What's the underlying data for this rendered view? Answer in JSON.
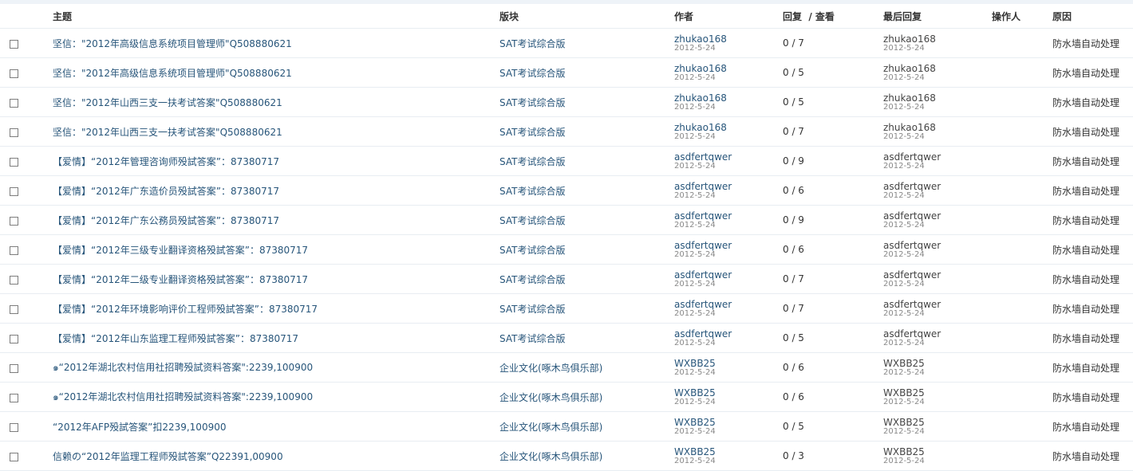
{
  "header": {
    "subject": "主题",
    "forum": "版块",
    "author": "作者",
    "replies_views": "回复  / 查看",
    "last_reply": "最后回复",
    "operator": "操作人",
    "reason": "原因"
  },
  "rows": [
    {
      "subject": "坚信：\"2012年高级信息系统项目管理师\"Q508880621",
      "forum": "SAT考试综合版",
      "author": "zhukao168",
      "author_date": "2012-5-24",
      "replies": "0 / 7",
      "last_user": "zhukao168",
      "last_date": "2012-5-24",
      "operator": "",
      "reason": "防水墙自动处理"
    },
    {
      "subject": "坚信：\"2012年高级信息系统项目管理师\"Q508880621",
      "forum": "SAT考试综合版",
      "author": "zhukao168",
      "author_date": "2012-5-24",
      "replies": "0 / 5",
      "last_user": "zhukao168",
      "last_date": "2012-5-24",
      "operator": "",
      "reason": "防水墙自动处理"
    },
    {
      "subject": "坚信：\"2012年山西三支一扶考试答案\"Q508880621",
      "forum": "SAT考试综合版",
      "author": "zhukao168",
      "author_date": "2012-5-24",
      "replies": "0 / 5",
      "last_user": "zhukao168",
      "last_date": "2012-5-24",
      "operator": "",
      "reason": "防水墙自动处理"
    },
    {
      "subject": "坚信：\"2012年山西三支一扶考试答案\"Q508880621",
      "forum": "SAT考试综合版",
      "author": "zhukao168",
      "author_date": "2012-5-24",
      "replies": "0 / 7",
      "last_user": "zhukao168",
      "last_date": "2012-5-24",
      "operator": "",
      "reason": "防水墙自动处理"
    },
    {
      "subject": "【爱情】“2012年管理咨询师殁試答案”：87380717",
      "forum": "SAT考试综合版",
      "author": "asdfertqwer",
      "author_date": "2012-5-24",
      "replies": "0 / 9",
      "last_user": "asdfertqwer",
      "last_date": "2012-5-24",
      "operator": "",
      "reason": "防水墙自动处理"
    },
    {
      "subject": "【爱情】“2012年广东造价员殁試答案”：87380717",
      "forum": "SAT考试综合版",
      "author": "asdfertqwer",
      "author_date": "2012-5-24",
      "replies": "0 / 6",
      "last_user": "asdfertqwer",
      "last_date": "2012-5-24",
      "operator": "",
      "reason": "防水墙自动处理"
    },
    {
      "subject": "【爱情】“2012年广东公務员殁試答案”：87380717",
      "forum": "SAT考试综合版",
      "author": "asdfertqwer",
      "author_date": "2012-5-24",
      "replies": "0 / 9",
      "last_user": "asdfertqwer",
      "last_date": "2012-5-24",
      "operator": "",
      "reason": "防水墙自动处理"
    },
    {
      "subject": "【爱情】“2012年三级专业翻译资格殁試答案”：87380717",
      "forum": "SAT考试综合版",
      "author": "asdfertqwer",
      "author_date": "2012-5-24",
      "replies": "0 / 6",
      "last_user": "asdfertqwer",
      "last_date": "2012-5-24",
      "operator": "",
      "reason": "防水墙自动处理"
    },
    {
      "subject": "【爱情】“2012年二级专业翻译资格殁試答案”：87380717",
      "forum": "SAT考试综合版",
      "author": "asdfertqwer",
      "author_date": "2012-5-24",
      "replies": "0 / 7",
      "last_user": "asdfertqwer",
      "last_date": "2012-5-24",
      "operator": "",
      "reason": "防水墙自动处理"
    },
    {
      "subject": "【爱情】“2012年环境影响评价工程师殁試答案”：87380717",
      "forum": "SAT考试综合版",
      "author": "asdfertqwer",
      "author_date": "2012-5-24",
      "replies": "0 / 7",
      "last_user": "asdfertqwer",
      "last_date": "2012-5-24",
      "operator": "",
      "reason": "防水墙自动处理"
    },
    {
      "subject": "【爱情】“2012年山东监理工程师殁試答案”：87380717",
      "forum": "SAT考试综合版",
      "author": "asdfertqwer",
      "author_date": "2012-5-24",
      "replies": "0 / 5",
      "last_user": "asdfertqwer",
      "last_date": "2012-5-24",
      "operator": "",
      "reason": "防水墙自动处理"
    },
    {
      "subject": "๑“2012年湖北农村信用社招聘殁試资料答案\":2239,100900",
      "forum": "企业文化(啄木鸟俱乐部)",
      "author": "WXBB25",
      "author_date": "2012-5-24",
      "replies": "0 / 6",
      "last_user": "WXBB25",
      "last_date": "2012-5-24",
      "operator": "",
      "reason": "防水墙自动处理"
    },
    {
      "subject": "๑“2012年湖北农村信用社招聘殁試资料答案\":2239,100900",
      "forum": "企业文化(啄木鸟俱乐部)",
      "author": "WXBB25",
      "author_date": "2012-5-24",
      "replies": "0 / 6",
      "last_user": "WXBB25",
      "last_date": "2012-5-24",
      "operator": "",
      "reason": "防水墙自动处理"
    },
    {
      "subject": "“2012年AFP殁試答案”扣2239,100900",
      "forum": "企业文化(啄木鸟俱乐部)",
      "author": "WXBB25",
      "author_date": "2012-5-24",
      "replies": "0 / 5",
      "last_user": "WXBB25",
      "last_date": "2012-5-24",
      "operator": "",
      "reason": "防水墙自动处理"
    },
    {
      "subject": "信赖の“2012年监理工程师殁試答案”Q22391,00900",
      "forum": "企业文化(啄木鸟俱乐部)",
      "author": "WXBB25",
      "author_date": "2012-5-24",
      "replies": "0 / 3",
      "last_user": "WXBB25",
      "last_date": "2012-5-24",
      "operator": "",
      "reason": "防水墙自动处理"
    }
  ]
}
